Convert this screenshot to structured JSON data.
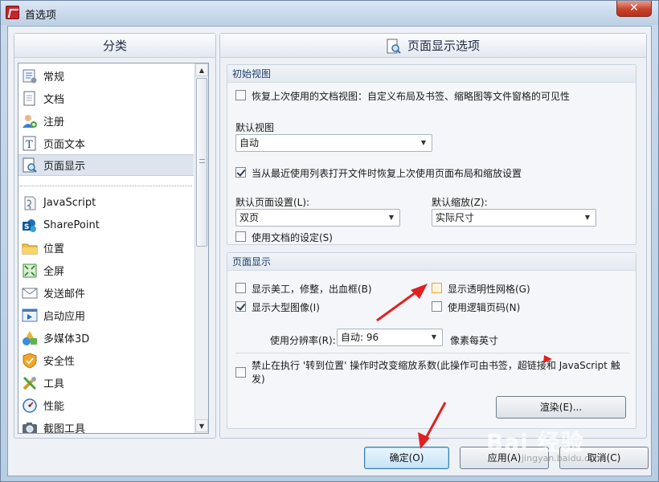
{
  "window": {
    "title": "首选项",
    "close_glyph": "✕"
  },
  "left": {
    "header": "分类",
    "items": [
      {
        "label": "常规",
        "icon": "general-icon"
      },
      {
        "label": "文档",
        "icon": "document-icon"
      },
      {
        "label": "注册",
        "icon": "register-icon"
      },
      {
        "label": "页面文本",
        "icon": "page-text-icon"
      },
      {
        "label": "页面显示",
        "icon": "page-display-icon",
        "selected": true
      },
      {
        "label": "JavaScript",
        "icon": "javascript-icon"
      },
      {
        "label": "SharePoint",
        "icon": "sharepoint-icon"
      },
      {
        "label": "位置",
        "icon": "folder-icon"
      },
      {
        "label": "全屏",
        "icon": "fullscreen-icon"
      },
      {
        "label": "发送邮件",
        "icon": "mail-icon"
      },
      {
        "label": "启动应用",
        "icon": "launch-app-icon"
      },
      {
        "label": "多媒体3D",
        "icon": "multimedia-3d-icon"
      },
      {
        "label": "安全性",
        "icon": "shield-icon"
      },
      {
        "label": "工具",
        "icon": "tools-icon"
      },
      {
        "label": "性能",
        "icon": "gauge-icon"
      },
      {
        "label": "截图工具",
        "icon": "camera-icon"
      }
    ]
  },
  "right": {
    "header": "页面显示选项",
    "initial_view": {
      "title": "初始视图",
      "restore_view_label": "恢复上次使用的文档视图：自定义布局及书签、缩略图等文件窗格的可见性",
      "default_view_label": "默认视图",
      "default_view_value": "自动",
      "restore_layout_label": "当从最近使用列表打开文件时恢复上次使用页面布局和缩放设置",
      "page_setup_label": "默认页面设置(L):",
      "page_setup_value": "双页",
      "zoom_label": "默认缩放(Z):",
      "zoom_value": "实际尺寸",
      "use_doc_settings_label": "使用文档的设定(S)"
    },
    "page_display": {
      "title": "页面显示",
      "show_art_label": "显示美工，修整，出血框(B)",
      "show_grid_label": "显示透明性网格(G)",
      "show_large_images_label": "显示大型图像(I)",
      "logical_page_label": "使用逻辑页码(N)",
      "resolution_label": "使用分辨率(R):",
      "resolution_value": "自动: 96",
      "resolution_unit": "像素每英寸",
      "disable_zoom_label": "禁止在执行 '转到位置' 操作时改变缩放系数(此操作可由书签，超链接和 JavaScript 触发)",
      "render_button": "渲染(E)..."
    }
  },
  "buttons": {
    "ok": "确定(O)",
    "apply": "应用(A)",
    "cancel": "取消(C)"
  },
  "checks": {
    "restore_view": false,
    "restore_layout": true,
    "use_doc_settings": false,
    "show_art": false,
    "show_grid": false,
    "show_large_images": true,
    "logical_page": false,
    "disable_zoom": false
  },
  "watermark": {
    "brand": "Bai 经验",
    "url": "jingyan.baidu.com"
  },
  "colors": {
    "annotation_arrow": "#e02020",
    "highlight_checkbox": "#e3a33c"
  }
}
